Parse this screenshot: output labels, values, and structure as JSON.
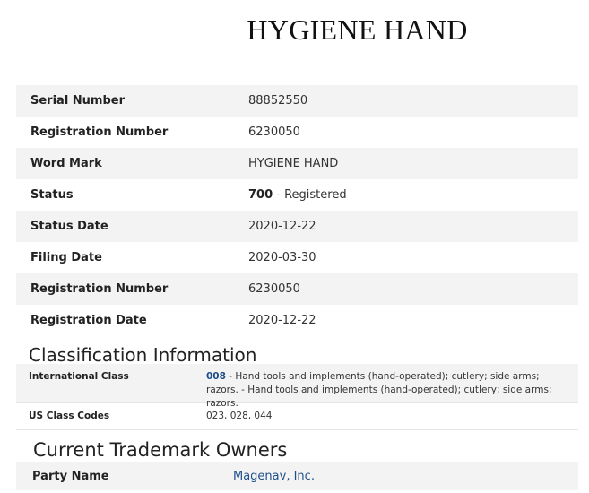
{
  "mark_title": "HYGIENE HAND",
  "details": [
    {
      "label": "Serial Number",
      "value": "88852550"
    },
    {
      "label": "Registration Number",
      "value": "6230050"
    },
    {
      "label": "Word Mark",
      "value": "HYGIENE HAND"
    },
    {
      "label": "Status",
      "value_bold": "700",
      "value": " - Registered"
    },
    {
      "label": "Status Date",
      "value": "2020-12-22"
    },
    {
      "label": "Filing Date",
      "value": "2020-03-30"
    },
    {
      "label": "Registration Number",
      "value": "6230050"
    },
    {
      "label": "Registration Date",
      "value": "2020-12-22"
    }
  ],
  "classification": {
    "title": "Classification Information",
    "international_class": {
      "label": "International Class",
      "code": "008",
      "text": " - Hand tools and implements (hand-operated); cutlery; side arms; razors. - Hand tools and implements (hand-operated); cutlery; side arms; razors."
    },
    "us_class_codes": {
      "label": "US Class Codes",
      "value": "023, 028, 044"
    }
  },
  "owners": {
    "title": "Current Trademark Owners",
    "party_name_label": "Party Name",
    "party_name_value": "Magenav, Inc."
  }
}
